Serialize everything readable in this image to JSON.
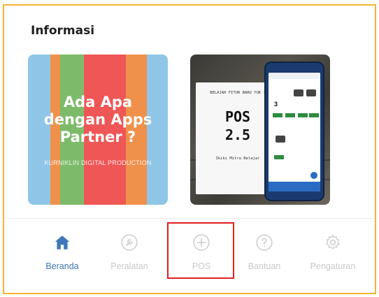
{
  "section_title": "Informasi",
  "cards": [
    {
      "headline_lines": [
        "Ada Apa",
        "dengan Apps",
        "Partner ?"
      ],
      "footer": "KURNIKLIN DIGITAL PRODUCTION",
      "stripe_colors": [
        "#8fc6e8",
        "#f0914b",
        "#7dbb6a",
        "#ef5656",
        "#ef5656",
        "#f0914b",
        "#8fc6e8"
      ]
    },
    {
      "top_text": "BELAJAH FITUR BARU YUK !",
      "big_lines": [
        "POS",
        "2.5"
      ],
      "bottom_text": "Ikiki Mitra Belajar",
      "screen_number": "3"
    }
  ],
  "nav": [
    {
      "label": "Beranda",
      "icon": "home-icon",
      "active": true
    },
    {
      "label": "Peralatan",
      "icon": "tools-icon",
      "active": false
    },
    {
      "label": "POS",
      "icon": "plus-circle-icon",
      "active": false
    },
    {
      "label": "Bantuan",
      "icon": "help-circle-icon",
      "active": false
    },
    {
      "label": "Pengaturan",
      "icon": "gear-icon",
      "active": false
    }
  ],
  "colors": {
    "frame_border": "#f5b335",
    "active": "#3f77b8",
    "inactive": "#c9c9c9",
    "highlight_box": "#e02020"
  }
}
